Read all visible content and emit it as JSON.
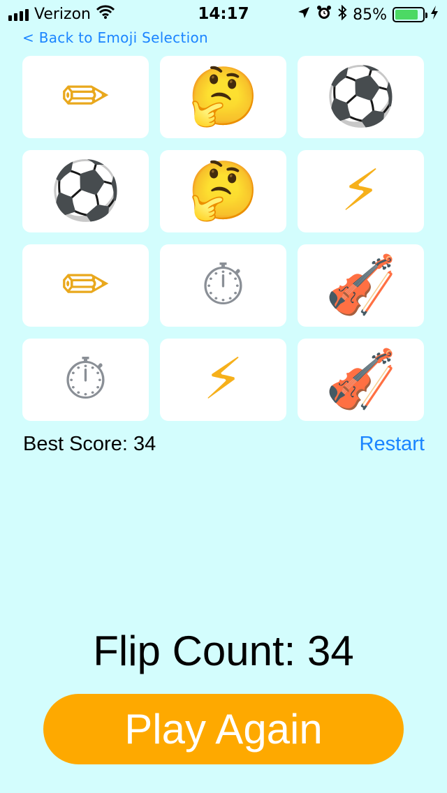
{
  "status_bar": {
    "carrier": "Verizon",
    "time": "14:17",
    "battery_percent": "85%",
    "battery_level": 0.85,
    "icons": [
      "signal-icon",
      "wifi-icon",
      "location-icon",
      "alarm-icon",
      "bluetooth-icon",
      "battery-icon",
      "charging-icon"
    ]
  },
  "nav": {
    "back_label": "< Back to Emoji Selection"
  },
  "cards": [
    {
      "emoji": "✏",
      "name": "pencil"
    },
    {
      "emoji": "🤔",
      "name": "thinking-face"
    },
    {
      "emoji": "⚽",
      "name": "soccer-ball"
    },
    {
      "emoji": "⚽",
      "name": "soccer-ball"
    },
    {
      "emoji": "🤔",
      "name": "thinking-face"
    },
    {
      "emoji": "⚡",
      "name": "lightning"
    },
    {
      "emoji": "✏",
      "name": "pencil"
    },
    {
      "emoji": "⏱",
      "name": "stopwatch"
    },
    {
      "emoji": "🎻",
      "name": "violin"
    },
    {
      "emoji": "⏱",
      "name": "stopwatch"
    },
    {
      "emoji": "⚡",
      "name": "lightning"
    },
    {
      "emoji": "🎻",
      "name": "violin"
    }
  ],
  "score": {
    "best_score_label": "Best Score: 34",
    "restart_label": "Restart",
    "flip_count_label": "Flip Count: 34"
  },
  "actions": {
    "play_again_label": "Play Again"
  },
  "colors": {
    "background": "#d3fdfd",
    "card": "#ffffff",
    "link": "#1a84ff",
    "play_button": "#fea900",
    "battery": "#4cd964"
  }
}
